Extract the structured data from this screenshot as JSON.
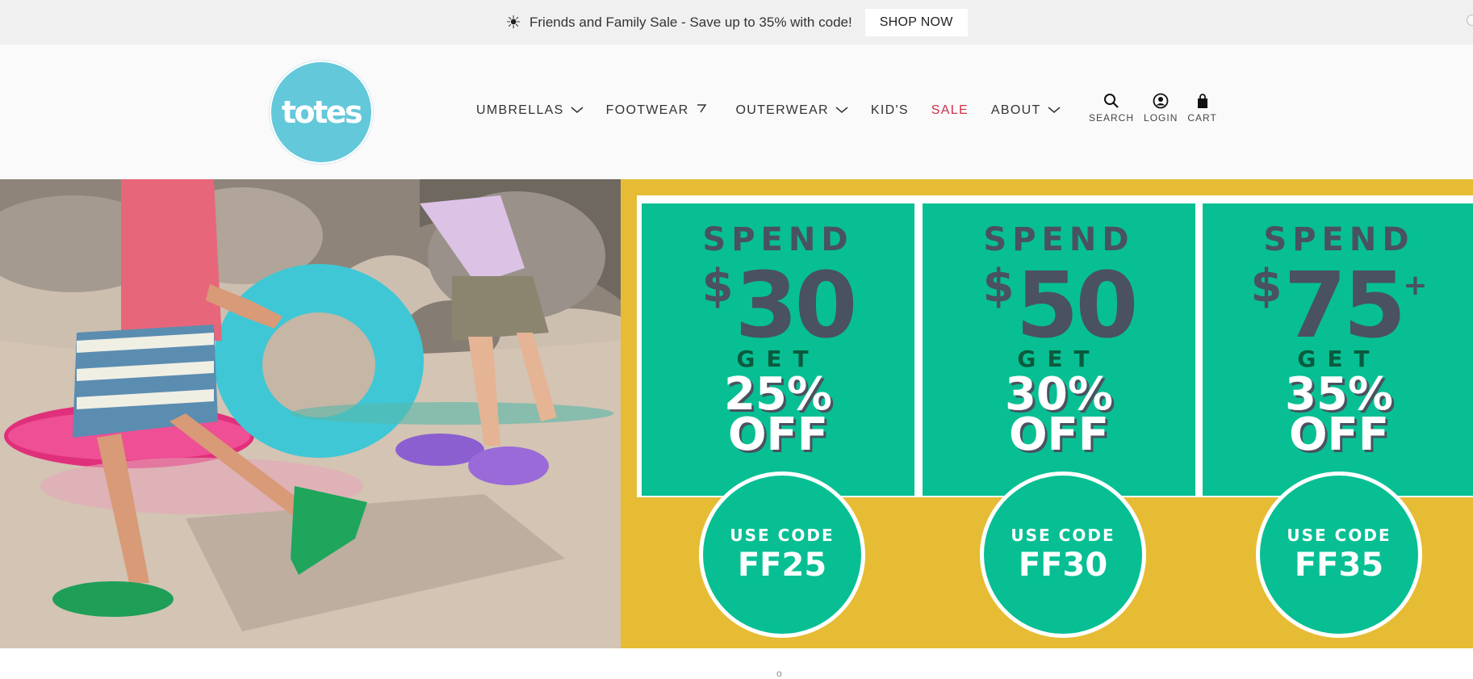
{
  "announcement": {
    "icon": "sun-icon",
    "message": "Friends and Family Sale - Save up to 35% with code!",
    "cta_label": "SHOP NOW"
  },
  "header": {
    "logo_text": "totes",
    "logo_color": "#63c8da",
    "nav": [
      {
        "label": "UMBRELLAS",
        "has_dropdown": true
      },
      {
        "label": "FOOTWEAR",
        "has_dropdown": true
      },
      {
        "label": "OUTERWEAR",
        "has_dropdown": true
      },
      {
        "label": "KID'S",
        "has_dropdown": false
      },
      {
        "label": "SALE",
        "has_dropdown": false,
        "color": "#d0304c"
      },
      {
        "label": "ABOUT",
        "has_dropdown": true
      }
    ],
    "utilities": [
      {
        "label": "SEARCH",
        "icon": "search-icon"
      },
      {
        "label": "LOGIN",
        "icon": "user-icon"
      },
      {
        "label": "CART",
        "icon": "bag-icon"
      }
    ]
  },
  "hero": {
    "photo_alt": "kids running on beach with inflatable rings wearing clogs",
    "colors": {
      "background": "#e6bc34",
      "panel": "#07bf93",
      "dark_text": "#4a5160"
    },
    "offers": [
      {
        "spend_label": "SPEND",
        "currency": "$",
        "amount": "30",
        "plus": "",
        "get_label": "GET",
        "percent": "25%",
        "off_label": "OFF",
        "use_code_label": "USE CODE",
        "code": "FF25"
      },
      {
        "spend_label": "SPEND",
        "currency": "$",
        "amount": "50",
        "plus": "",
        "get_label": "GET",
        "percent": "30%",
        "off_label": "OFF",
        "use_code_label": "USE CODE",
        "code": "FF30"
      },
      {
        "spend_label": "SPEND",
        "currency": "$",
        "amount": "75",
        "plus": "+",
        "get_label": "GET",
        "percent": "35%",
        "off_label": "OFF",
        "use_code_label": "USE CODE",
        "code": "FF35"
      }
    ]
  },
  "below": {
    "indicator": "o"
  }
}
